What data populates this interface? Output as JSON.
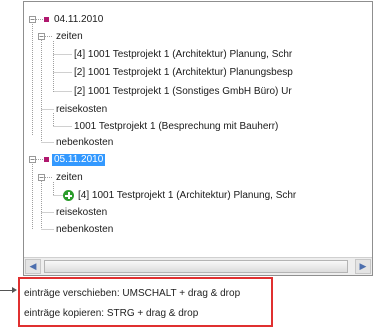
{
  "tree": {
    "day1": {
      "date": "04.11.2010",
      "zeiten_label": "zeiten",
      "zeiten_items": [
        "[4]  1001  Testprojekt 1 (Architektur) Planung, Schr",
        "[2]  1001  Testprojekt 1 (Architektur) Planungsbesp",
        "[2]  1001  Testprojekt 1 (Sonstiges GmbH Büro) Ur"
      ],
      "reisekosten_label": "reisekosten",
      "reisekosten_items": [
        "1001  Testprojekt 1 (Besprechung mit Bauherr)"
      ],
      "nebenkosten_label": "nebenkosten"
    },
    "day2": {
      "date": "05.11.2010",
      "zeiten_label": "zeiten",
      "zeiten_items": [
        "[4]  1001  Testprojekt 1 (Architektur) Planung, Schr"
      ],
      "reisekosten_label": "reisekosten",
      "nebenkosten_label": "nebenkosten"
    }
  },
  "scrollbar": {
    "left_arrow": "◀",
    "right_arrow": "▶"
  },
  "hints": {
    "move": "einträge verschieben: UMSCHALT + drag & drop",
    "copy": "einträge kopieren: STRG + drag & drop"
  },
  "icons": {
    "expander_minus": "−",
    "add": "add-icon"
  },
  "colors": {
    "date_marker": "#b0186e",
    "selection": "#3399ff",
    "hint_border": "#e03030",
    "add_icon": "#2b9c2b"
  }
}
